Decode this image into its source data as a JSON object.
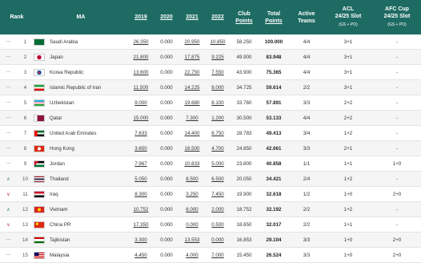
{
  "headers": {
    "rank": "Rank",
    "ma": "MA",
    "y2019": "2019",
    "y2020": "2020",
    "y2021": "2021",
    "y2022": "2022",
    "club_points_1": "Club",
    "club_points_2": "Points",
    "total_points_1": "Total",
    "total_points_2": "Points",
    "active_teams_1": "Active",
    "active_teams_2": "Teams",
    "acl_1": "ACL",
    "acl_2": "24/25 Slot",
    "acl_sub": "(GS + PO)",
    "afc_1": "AFC Cup",
    "afc_2": "24/25 Slot",
    "afc_sub": "(GS + PO)"
  },
  "rows": [
    {
      "chg": "—",
      "rank": "1",
      "name": "Saudi Arabia",
      "y2019": "26.350",
      "y2020": "0.000",
      "y2021": "20.950",
      "y2022": "10.850",
      "club": "58.250",
      "total": "100.000",
      "teams": "4/4",
      "acl": "3+1",
      "afc": "-"
    },
    {
      "chg": "—",
      "rank": "2",
      "name": "Japan",
      "y2019": "21.800",
      "y2020": "0.000",
      "y2021": "17.875",
      "y2022": "9.225",
      "club": "49.900",
      "total": "83.948",
      "teams": "4/4",
      "acl": "3+1",
      "afc": "-"
    },
    {
      "chg": "—",
      "rank": "3",
      "name": "Korea Republic",
      "y2019": "13.600",
      "y2020": "0.000",
      "y2021": "22.750",
      "y2022": "7.550",
      "club": "43.900",
      "total": "75.365",
      "teams": "4/4",
      "acl": "3+1",
      "afc": "-"
    },
    {
      "chg": "—",
      "rank": "4",
      "name": "Islamic Republic of Iran",
      "y2019": "11.500",
      "y2020": "0.000",
      "y2021": "14.225",
      "y2022": "8.000",
      "club": "34.725",
      "total": "59.614",
      "teams": "2/2",
      "acl": "3+1",
      "afc": "-"
    },
    {
      "chg": "—",
      "rank": "5",
      "name": "Uzbekistan",
      "y2019": "9.000",
      "y2020": "0.000",
      "y2021": "19.680",
      "y2022": "8.100",
      "club": "33.760",
      "total": "57.891",
      "teams": "3/3",
      "acl": "2+2",
      "afc": "-"
    },
    {
      "chg": "—",
      "rank": "6",
      "name": "Qatar",
      "y2019": "15.000",
      "y2020": "0.000",
      "y2021": "7.300",
      "y2022": "1.200",
      "club": "30.500",
      "total": "53.133",
      "teams": "4/4",
      "acl": "2+2",
      "afc": "-"
    },
    {
      "chg": "—",
      "rank": "7",
      "name": "United Arab Emirates",
      "y2019": "7.633",
      "y2020": "0.000",
      "y2021": "14.400",
      "y2022": "6.750",
      "club": "28.783",
      "total": "49.413",
      "teams": "3/4",
      "acl": "1+2",
      "afc": "-"
    },
    {
      "chg": "—",
      "rank": "8",
      "name": "Hong Kong",
      "y2019": "3.650",
      "y2020": "0.000",
      "y2021": "16.500",
      "y2022": "4.700",
      "club": "24.850",
      "total": "42.661",
      "teams": "3/3",
      "acl": "2+1",
      "afc": "-"
    },
    {
      "chg": "—",
      "rank": "9",
      "name": "Jordan",
      "y2019": "7.967",
      "y2020": "0.000",
      "y2021": "10.833",
      "y2022": "5.000",
      "club": "23.800",
      "total": "40.858",
      "teams": "1/1",
      "acl": "1+1",
      "afc": "1+0"
    },
    {
      "chg": "^",
      "rank": "10",
      "name": "Thailand",
      "y2019": "5.050",
      "y2020": "0.000",
      "y2021": "8.500",
      "y2022": "6.500",
      "club": "20.050",
      "total": "34.421",
      "teams": "2/4",
      "acl": "1+2",
      "afc": "-"
    },
    {
      "chg": "v",
      "rank": "11",
      "name": "Iraq",
      "y2019": "8.300",
      "y2020": "0.000",
      "y2021": "3.250",
      "y2022": "7.450",
      "club": "19.900",
      "total": "32.618",
      "teams": "1/2",
      "acl": "1+0",
      "afc": "2+0"
    },
    {
      "chg": "^",
      "rank": "12",
      "name": "Vietnam",
      "y2019": "10.752",
      "y2020": "0.000",
      "y2021": "6.000",
      "y2022": "2.000",
      "club": "18.752",
      "total": "32.192",
      "teams": "2/2",
      "acl": "1+2",
      "afc": "-"
    },
    {
      "chg": "v",
      "rank": "13",
      "name": "China PR",
      "y2019": "17.350",
      "y2020": "0.000",
      "y2021": "0.000",
      "y2022": "0.500",
      "club": "18.650",
      "total": "32.017",
      "teams": "2/2",
      "acl": "1+1",
      "afc": "-"
    },
    {
      "chg": "—",
      "rank": "14",
      "name": "Tajikistan",
      "y2019": "3.300",
      "y2020": "0.000",
      "y2021": "13.553",
      "y2022": "0.000",
      "club": "16.853",
      "total": "29.104",
      "teams": "3/3",
      "acl": "1+0",
      "afc": "2+0"
    },
    {
      "chg": "—",
      "rank": "15",
      "name": "Malaysia",
      "y2019": "4.450",
      "y2020": "0.000",
      "y2021": "4.000",
      "y2022": "7.000",
      "club": "15.450",
      "total": "26.524",
      "teams": "3/3",
      "acl": "1+0",
      "afc": "2+0"
    }
  ]
}
